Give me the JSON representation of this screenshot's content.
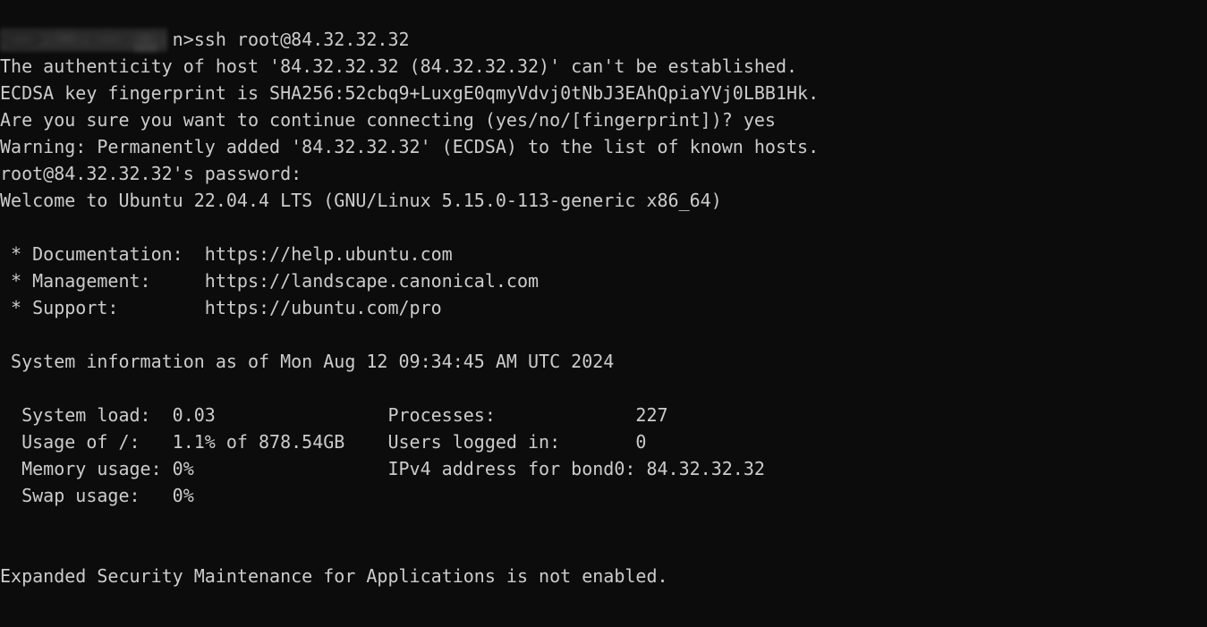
{
  "terminal": {
    "app": "ssh-session",
    "background_color": "#0c0c0c",
    "foreground_color": "#cccccc",
    "font_size_px": 20,
    "line_height_px": 30,
    "redacted_prompt_note": "blurred-local-prompt-path"
  },
  "lines": [
    {
      "id": "prompt-command",
      "text": "                n>ssh root@84.32.32.32",
      "redacted_prefix": true
    },
    {
      "id": "host-authenticity",
      "text": "The authenticity of host '84.32.32.32 (84.32.32.32)' can't be established."
    },
    {
      "id": "ecdsa-fingerprint",
      "text": "ECDSA key fingerprint is SHA256:52cbq9+LuxgE0qmyVdvj0tNbJ3EAhQpiaYVj0LBB1Hk."
    },
    {
      "id": "continue-prompt",
      "text": "Are you sure you want to continue connecting (yes/no/[fingerprint])? yes"
    },
    {
      "id": "known-hosts-warning",
      "text": "Warning: Permanently added '84.32.32.32' (ECDSA) to the list of known hosts."
    },
    {
      "id": "password-prompt",
      "text": "root@84.32.32.32's password:"
    },
    {
      "id": "welcome-banner",
      "text": "Welcome to Ubuntu 22.04.4 LTS (GNU/Linux 5.15.0-113-generic x86_64)"
    },
    {
      "id": "blank-1",
      "text": ""
    },
    {
      "id": "link-documentation",
      "text": " * Documentation:  https://help.ubuntu.com"
    },
    {
      "id": "link-management",
      "text": " * Management:     https://landscape.canonical.com"
    },
    {
      "id": "link-support",
      "text": " * Support:        https://ubuntu.com/pro"
    },
    {
      "id": "blank-2",
      "text": ""
    },
    {
      "id": "system-info-header",
      "text": " System information as of Mon Aug 12 09:34:45 AM UTC 2024"
    },
    {
      "id": "blank-3",
      "text": ""
    },
    {
      "id": "stat-row-1",
      "text": "  System load:  0.03                Processes:             227"
    },
    {
      "id": "stat-row-2",
      "text": "  Usage of /:   1.1% of 878.54GB    Users logged in:       0"
    },
    {
      "id": "stat-row-3",
      "text": "  Memory usage: 0%                  IPv4 address for bond0: 84.32.32.32"
    },
    {
      "id": "stat-row-4",
      "text": "  Swap usage:   0%"
    },
    {
      "id": "blank-4",
      "text": ""
    },
    {
      "id": "blank-5",
      "text": ""
    },
    {
      "id": "esm-notice",
      "text": "Expanded Security Maintenance for Applications is not enabled."
    }
  ],
  "parsed": {
    "command": "ssh root@84.32.32.32",
    "host": "84.32.32.32",
    "user": "root",
    "key_type": "ECDSA",
    "fingerprint": "SHA256:52cbq9+LuxgE0qmyVdvj0tNbJ3EAhQpiaYVj0LBB1Hk.",
    "continue_answer": "yes",
    "os": "Ubuntu 22.04.4 LTS",
    "kernel": "GNU/Linux 5.15.0-113-generic x86_64",
    "documentation_url": "https://help.ubuntu.com",
    "management_url": "https://landscape.canonical.com",
    "support_url": "https://ubuntu.com/pro",
    "system_info_time": "Mon Aug 12 09:34:45 AM UTC 2024",
    "system_load": "0.03",
    "usage_of_root": "1.1% of 878.54GB",
    "memory_usage": "0%",
    "swap_usage": "0%",
    "processes": "227",
    "users_logged_in": "0",
    "ipv4_interface": "bond0",
    "ipv4_address": "84.32.32.32",
    "esm_status": "Expanded Security Maintenance for Applications is not enabled."
  }
}
